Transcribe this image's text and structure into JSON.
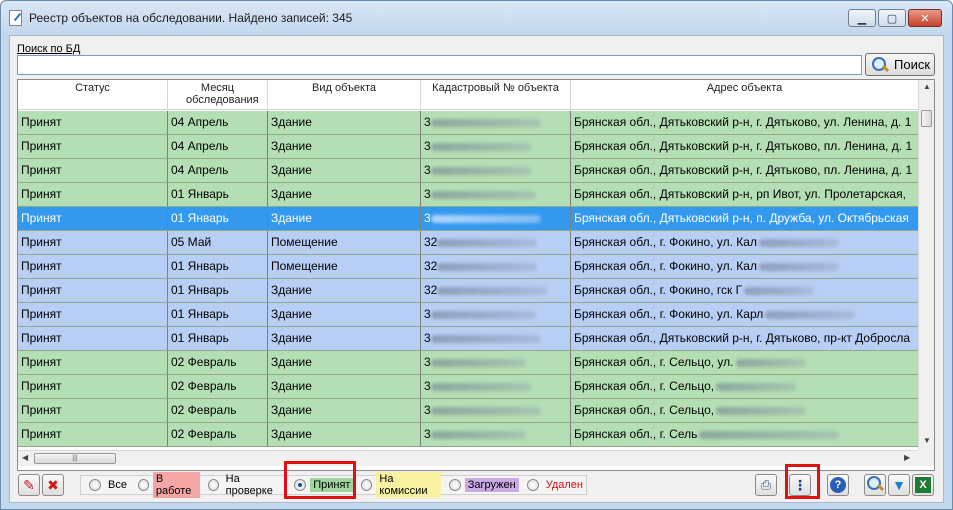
{
  "window": {
    "title": "Реестр объектов на обследовании. Найдено записей: 345",
    "controls": {
      "minimize": "▁",
      "maximize": "▢",
      "close": "✕"
    }
  },
  "search": {
    "label": "Поиск по БД",
    "value": "",
    "button_label": "Поиск",
    "button_icon": "magnifier-icon"
  },
  "table": {
    "columns": [
      "Статус",
      "Месяц обследования",
      "Вид объекта",
      "Кадастровый № объекта",
      "Адрес объекта"
    ],
    "rows": [
      {
        "status": "Принят",
        "month": "04 Апрель",
        "type": "Здание",
        "cad_prefix": "3",
        "address": "Брянская обл., Дятьковский р-н, г. Дятьково, ул. Ленина, д. 1",
        "color": "green"
      },
      {
        "status": "Принят",
        "month": "04 Апрель",
        "type": "Здание",
        "cad_prefix": "3",
        "address": "Брянская обл., Дятьковский р-н, г. Дятьково, пл. Ленина, д. 1",
        "color": "green"
      },
      {
        "status": "Принят",
        "month": "04 Апрель",
        "type": "Здание",
        "cad_prefix": "3",
        "address": "Брянская обл., Дятьковский р-н, г. Дятьково, пл. Ленина, д. 1",
        "color": "green"
      },
      {
        "status": "Принят",
        "month": "01 Январь",
        "type": "Здание",
        "cad_prefix": "3",
        "address": "Брянская обл., Дятьковский р-н, рп Ивот, ул. Пролетарская,",
        "color": "green"
      },
      {
        "status": "Принят",
        "month": "01 Январь",
        "type": "Здание",
        "cad_prefix": "3",
        "address": "Брянская обл., Дятьковский р-н, п. Дружба, ул. Октябрьская",
        "color": "sel"
      },
      {
        "status": "Принят",
        "month": "05 Май",
        "type": "Помещение",
        "cad_prefix": "32",
        "address": "Брянская обл., г. Фокино, ул. Кал",
        "color": "blue"
      },
      {
        "status": "Принят",
        "month": "01 Январь",
        "type": "Помещение",
        "cad_prefix": "32",
        "address": "Брянская обл., г. Фокино, ул. Кал",
        "color": "blue"
      },
      {
        "status": "Принят",
        "month": "01 Январь",
        "type": "Здание",
        "cad_prefix": "32",
        "address": "Брянская обл., г. Фокино, гск Г",
        "color": "blue"
      },
      {
        "status": "Принят",
        "month": "01 Январь",
        "type": "Здание",
        "cad_prefix": "3",
        "address": "Брянская обл., г. Фокино, ул. Карл",
        "color": "blue"
      },
      {
        "status": "Принят",
        "month": "01 Январь",
        "type": "Здание",
        "cad_prefix": "3",
        "address": "Брянская обл., Дятьковский р-н, г. Дятьково, пр-кт Добросла",
        "color": "blue"
      },
      {
        "status": "Принят",
        "month": "02 Февраль",
        "type": "Здание",
        "cad_prefix": "3",
        "address": "Брянская обл., г. Сельцо, ул.",
        "color": "green"
      },
      {
        "status": "Принят",
        "month": "02 Февраль",
        "type": "Здание",
        "cad_prefix": "3",
        "address": "Брянская обл., г. Сельцо,",
        "color": "green"
      },
      {
        "status": "Принят",
        "month": "02 Февраль",
        "type": "Здание",
        "cad_prefix": "3",
        "address": "Брянская обл., г. Сельцо,",
        "color": "green"
      },
      {
        "status": "Принят",
        "month": "02 Февраль",
        "type": "Здание",
        "cad_prefix": "3",
        "address": "Брянская обл., г. Сель",
        "color": "green"
      }
    ]
  },
  "filters": {
    "options": [
      {
        "label": "Все",
        "class": "",
        "checked": false
      },
      {
        "label": "В работе",
        "class": "lbl-work",
        "checked": false
      },
      {
        "label": "На проверке",
        "class": "",
        "checked": false
      },
      {
        "label": "Принят",
        "class": "lbl-acc",
        "checked": true
      },
      {
        "label": "На комиссии",
        "class": "lbl-com",
        "checked": false
      },
      {
        "label": "Загружен",
        "class": "lbl-load",
        "checked": false
      },
      {
        "label": "Удален",
        "class": "lbl-del",
        "checked": false
      }
    ]
  },
  "toolbar": {
    "edit_icon": "pencil-icon",
    "delete_icon": "delete-icon",
    "print_icon": "printer-icon",
    "columns_icon": "kebab-menu-icon",
    "help_icon": "help-icon",
    "search_icon": "magnifier-icon",
    "filter_icon": "funnel-icon",
    "excel_icon": "excel-icon"
  },
  "colors": {
    "row_green": "#b4dfb4",
    "row_blue": "#b7cff5",
    "row_selected": "#3399ee",
    "highlight": "#e01010"
  }
}
